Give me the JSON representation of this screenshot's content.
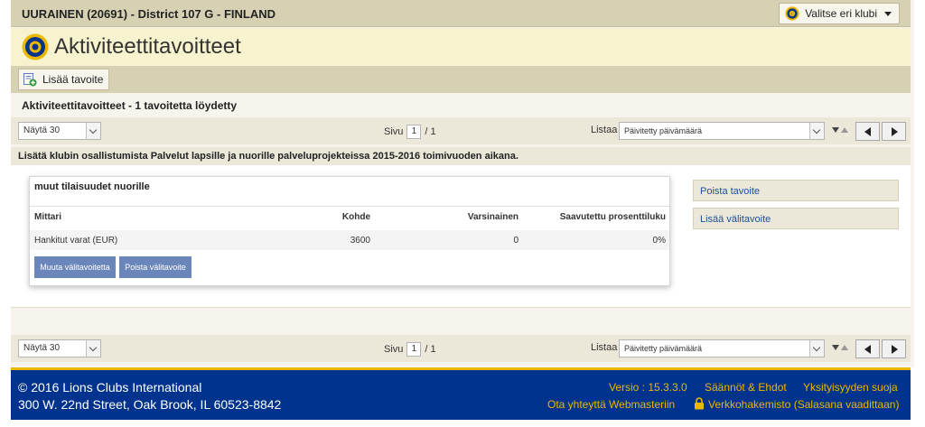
{
  "club": {
    "title": "UURAINEN (20691) - District 107 G - FINLAND",
    "select_label": "Valitse eri klubi"
  },
  "page": {
    "title": "Aktiviteettitavoitteet"
  },
  "toolbar": {
    "add_label": "Lisää tavoite"
  },
  "results_text": "Aktiviteettitavoitteet - 1 tavoitetta löydetty",
  "pager": {
    "page_size_label": "Näytä 30",
    "page_label": "Sivu",
    "page_current": "1",
    "page_total": "/ 1",
    "sort_label": "Listaa",
    "sort_value": "Päivitetty päivämäärä"
  },
  "goal": {
    "description": "Lisätä klubin osallistumista Palvelut lapsille ja nuorille palveluprojekteissa 2015-2016 toimivuoden aikana.",
    "card": {
      "title": "muut tilaisuudet nuorille",
      "headers": {
        "mittari": "Mittari",
        "kohde": "Kohde",
        "varsinainen": "Varsinainen",
        "saavutettu": "Saavutettu prosenttiluku"
      },
      "row": {
        "mittari": "Hankitut varat (EUR)",
        "kohde": "3600",
        "varsinainen": "0",
        "saavutettu": "0%"
      },
      "edit_button": "Muuta välitavoitetta",
      "delete_button": "Poista välitavoite"
    },
    "side": {
      "delete_goal": "Poista tavoite",
      "add_subgoal": "Lisää välitavoite"
    }
  },
  "footer": {
    "copyright": "© 2016 Lions Clubs International",
    "address": "300 W. 22nd Street, Oak Brook, IL 60523-8842",
    "version": "Versio : 15.3.3.0",
    "terms": "Säännöt & Ehdot",
    "privacy": "Yksityisyyden suoja",
    "contact": "Ota yhteyttä Webmasteriin",
    "directory": "Verkkohakemisto (Salasana vaadittaan)"
  },
  "colors": {
    "header_bg": "#d7d1b4",
    "title_bg": "#f7f3cf",
    "footer_bg": "#00338d",
    "footer_accent": "#ebb700",
    "button_blue": "#6a86ba",
    "link_blue": "#1c4f9a"
  },
  "icons": {
    "club_select": "lions-logo-icon",
    "page_title": "lions-logo-icon",
    "add_goal": "add-document-icon",
    "sort": "sort-arrows-icon",
    "prev": "arrow-left-icon",
    "next": "arrow-right-icon",
    "lock": "lock-icon"
  }
}
